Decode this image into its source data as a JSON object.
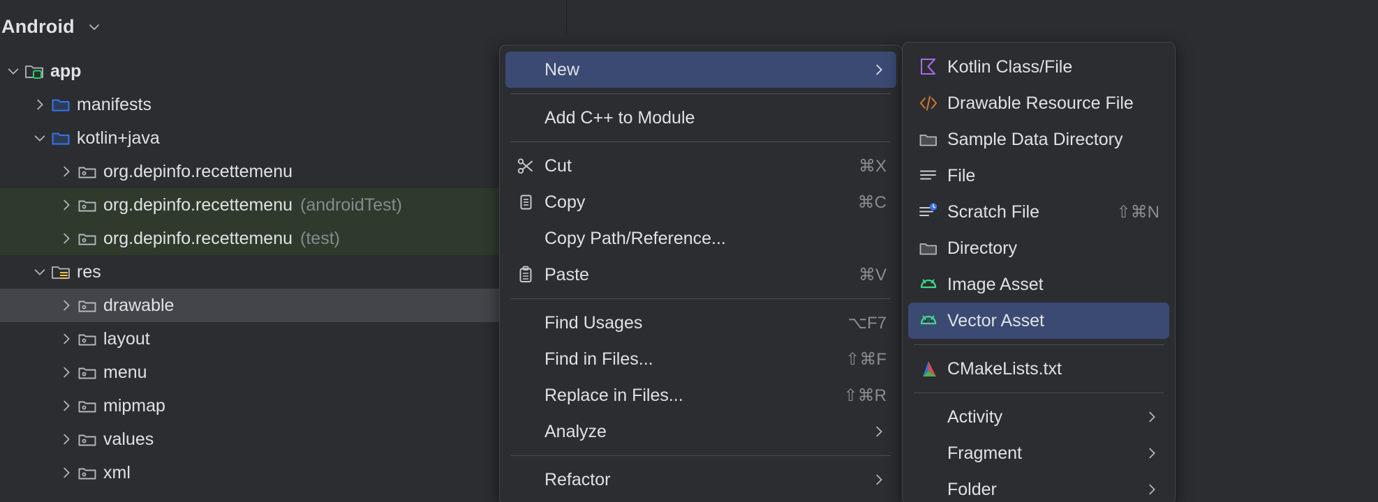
{
  "tool_window": {
    "title": "Android",
    "dropdown_icon": "chevron-down-icon",
    "tree": [
      {
        "label": "app",
        "suffix": "",
        "indent": 0,
        "arrow": "down",
        "icon": "module-folder-icon",
        "bold": true,
        "state": "none"
      },
      {
        "label": "manifests",
        "suffix": "",
        "indent": 1,
        "arrow": "right",
        "icon": "blue-folder-icon",
        "bold": false,
        "state": "none"
      },
      {
        "label": "kotlin+java",
        "suffix": "",
        "indent": 1,
        "arrow": "down",
        "icon": "blue-folder-icon",
        "bold": false,
        "state": "none"
      },
      {
        "label": "org.depinfo.recettemenu",
        "suffix": "",
        "indent": 2,
        "arrow": "right",
        "icon": "package-icon",
        "bold": false,
        "state": "none"
      },
      {
        "label": "org.depinfo.recettemenu",
        "suffix": "(androidTest)",
        "indent": 2,
        "arrow": "right",
        "icon": "package-icon",
        "bold": false,
        "state": "green"
      },
      {
        "label": "org.depinfo.recettemenu",
        "suffix": "(test)",
        "indent": 2,
        "arrow": "right",
        "icon": "package-icon",
        "bold": false,
        "state": "green"
      },
      {
        "label": "res",
        "suffix": "",
        "indent": 1,
        "arrow": "down",
        "icon": "res-folder-icon",
        "bold": false,
        "state": "none"
      },
      {
        "label": "drawable",
        "suffix": "",
        "indent": 2,
        "arrow": "right",
        "icon": "package-icon",
        "bold": false,
        "state": "gray"
      },
      {
        "label": "layout",
        "suffix": "",
        "indent": 2,
        "arrow": "right",
        "icon": "package-icon",
        "bold": false,
        "state": "none"
      },
      {
        "label": "menu",
        "suffix": "",
        "indent": 2,
        "arrow": "right",
        "icon": "package-icon",
        "bold": false,
        "state": "none"
      },
      {
        "label": "mipmap",
        "suffix": "",
        "indent": 2,
        "arrow": "right",
        "icon": "package-icon",
        "bold": false,
        "state": "none"
      },
      {
        "label": "values",
        "suffix": "",
        "indent": 2,
        "arrow": "right",
        "icon": "package-icon",
        "bold": false,
        "state": "none"
      },
      {
        "label": "xml",
        "suffix": "",
        "indent": 2,
        "arrow": "right",
        "icon": "package-icon",
        "bold": false,
        "state": "none"
      }
    ]
  },
  "context_menu": {
    "items": [
      {
        "label": "New",
        "shortcut": "",
        "icon": "",
        "submenu": true,
        "highlight": true,
        "sep_after": true
      },
      {
        "label": "Add C++ to Module",
        "shortcut": "",
        "icon": "",
        "submenu": false,
        "highlight": false,
        "sep_after": true
      },
      {
        "label": "Cut",
        "shortcut": "⌘X",
        "icon": "scissors-icon",
        "submenu": false,
        "highlight": false,
        "sep_after": false
      },
      {
        "label": "Copy",
        "shortcut": "⌘C",
        "icon": "copy-icon",
        "submenu": false,
        "highlight": false,
        "sep_after": false
      },
      {
        "label": "Copy Path/Reference...",
        "shortcut": "",
        "icon": "",
        "submenu": false,
        "highlight": false,
        "sep_after": false
      },
      {
        "label": "Paste",
        "shortcut": "⌘V",
        "icon": "paste-icon",
        "submenu": false,
        "highlight": false,
        "sep_after": true
      },
      {
        "label": "Find Usages",
        "shortcut": "⌥F7",
        "icon": "",
        "submenu": false,
        "highlight": false,
        "sep_after": false
      },
      {
        "label": "Find in Files...",
        "shortcut": "⇧⌘F",
        "icon": "",
        "submenu": false,
        "highlight": false,
        "sep_after": false
      },
      {
        "label": "Replace in Files...",
        "shortcut": "⇧⌘R",
        "icon": "",
        "submenu": false,
        "highlight": false,
        "sep_after": false
      },
      {
        "label": "Analyze",
        "shortcut": "",
        "icon": "",
        "submenu": true,
        "highlight": false,
        "sep_after": true
      },
      {
        "label": "Refactor",
        "shortcut": "",
        "icon": "",
        "submenu": true,
        "highlight": false,
        "sep_after": false
      }
    ]
  },
  "new_submenu": {
    "items": [
      {
        "label": "Kotlin Class/File",
        "shortcut": "",
        "icon": "kotlin-icon",
        "submenu": false,
        "highlight": false,
        "sep_after": false
      },
      {
        "label": "Drawable Resource File",
        "shortcut": "",
        "icon": "code-tag-icon",
        "submenu": false,
        "highlight": false,
        "sep_after": false
      },
      {
        "label": "Sample Data Directory",
        "shortcut": "",
        "icon": "folder-icon",
        "submenu": false,
        "highlight": false,
        "sep_after": false
      },
      {
        "label": "File",
        "shortcut": "",
        "icon": "file-lines-icon",
        "submenu": false,
        "highlight": false,
        "sep_after": false
      },
      {
        "label": "Scratch File",
        "shortcut": "⇧⌘N",
        "icon": "scratch-file-icon",
        "submenu": false,
        "highlight": false,
        "sep_after": false
      },
      {
        "label": "Directory",
        "shortcut": "",
        "icon": "folder-icon",
        "submenu": false,
        "highlight": false,
        "sep_after": false
      },
      {
        "label": "Image Asset",
        "shortcut": "",
        "icon": "android-icon",
        "submenu": false,
        "highlight": false,
        "sep_after": false
      },
      {
        "label": "Vector Asset",
        "shortcut": "",
        "icon": "android-icon",
        "submenu": false,
        "highlight": true,
        "sep_after": true
      },
      {
        "label": "CMakeLists.txt",
        "shortcut": "",
        "icon": "cmake-icon",
        "submenu": false,
        "highlight": false,
        "sep_after": true
      },
      {
        "label": "Activity",
        "shortcut": "",
        "icon": "",
        "submenu": true,
        "highlight": false,
        "sep_after": false
      },
      {
        "label": "Fragment",
        "shortcut": "",
        "icon": "",
        "submenu": true,
        "highlight": false,
        "sep_after": false
      },
      {
        "label": "Folder",
        "shortcut": "",
        "icon": "",
        "submenu": true,
        "highlight": false,
        "sep_after": false
      }
    ]
  },
  "colors": {
    "background": "#2b2d30",
    "menu_highlight": "#3b4a72",
    "tree_selection_gray": "#43454a",
    "tree_selection_green": "#2f3a2c",
    "text": "#dfe1e5",
    "muted_text": "#868a91",
    "kotlin_purple": "#a96ae8",
    "drawable_orange": "#cc7832",
    "android_green": "#3ddc84",
    "blue_folder": "#3574f0",
    "module_green": "#2ecc71",
    "res_yellow": "#e8bf52",
    "scratch_badge_blue": "#3574f0"
  }
}
